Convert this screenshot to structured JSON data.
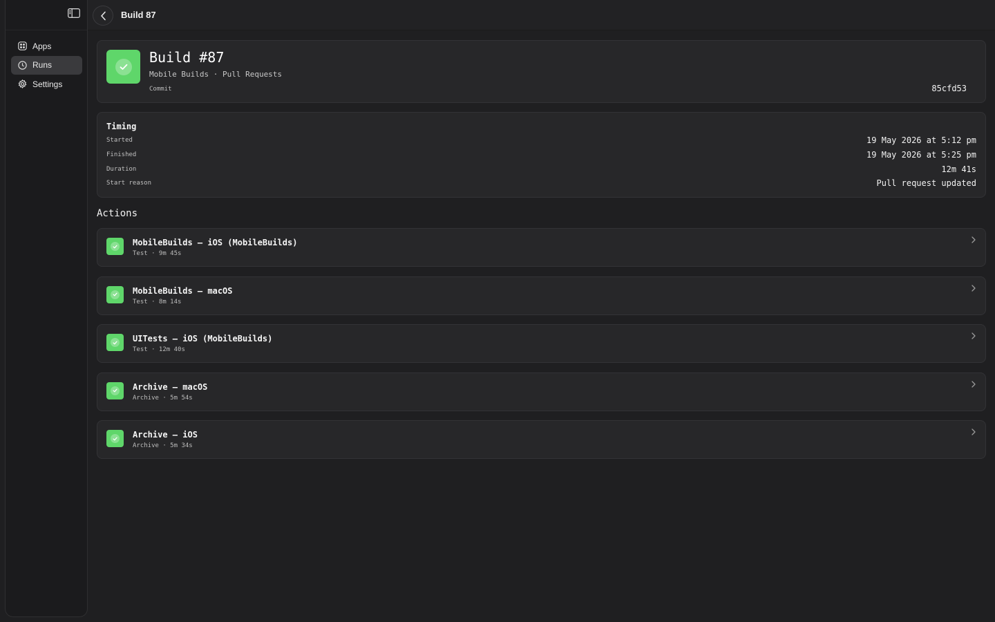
{
  "window": {
    "title": "Build 87"
  },
  "sidebar": {
    "items": [
      {
        "label": "Apps",
        "icon": "apps-icon",
        "active": false
      },
      {
        "label": "Runs",
        "icon": "clock-icon",
        "active": true
      },
      {
        "label": "Settings",
        "icon": "gear-icon",
        "active": false
      }
    ]
  },
  "build": {
    "title": "Build #87",
    "subtitle": "Mobile Builds · Pull Requests",
    "commit_label": "Commit",
    "commit_value": "85cfd53",
    "status": "success"
  },
  "timing": {
    "title": "Timing",
    "rows": [
      {
        "key": "Started",
        "value": "19 May 2026 at 5:12 pm"
      },
      {
        "key": "Finished",
        "value": "19 May 2026 at 5:25 pm"
      },
      {
        "key": "Duration",
        "value": "12m 41s"
      },
      {
        "key": "Start reason",
        "value": "Pull request updated"
      }
    ]
  },
  "actions": {
    "title": "Actions",
    "items": [
      {
        "name": "MobileBuilds – iOS (MobileBuilds)",
        "meta": "Test · 9m 45s",
        "status": "success"
      },
      {
        "name": "MobileBuilds – macOS",
        "meta": "Test · 8m 14s",
        "status": "success"
      },
      {
        "name": "UITests – iOS (MobileBuilds)",
        "meta": "Test · 12m 40s",
        "status": "success"
      },
      {
        "name": "Archive – macOS",
        "meta": "Archive · 5m 54s",
        "status": "success"
      },
      {
        "name": "Archive – iOS",
        "meta": "Archive · 5m 34s",
        "status": "success"
      }
    ]
  },
  "colors": {
    "success": "#5fd66a",
    "background": "#1f1f21",
    "card": "#272729"
  }
}
